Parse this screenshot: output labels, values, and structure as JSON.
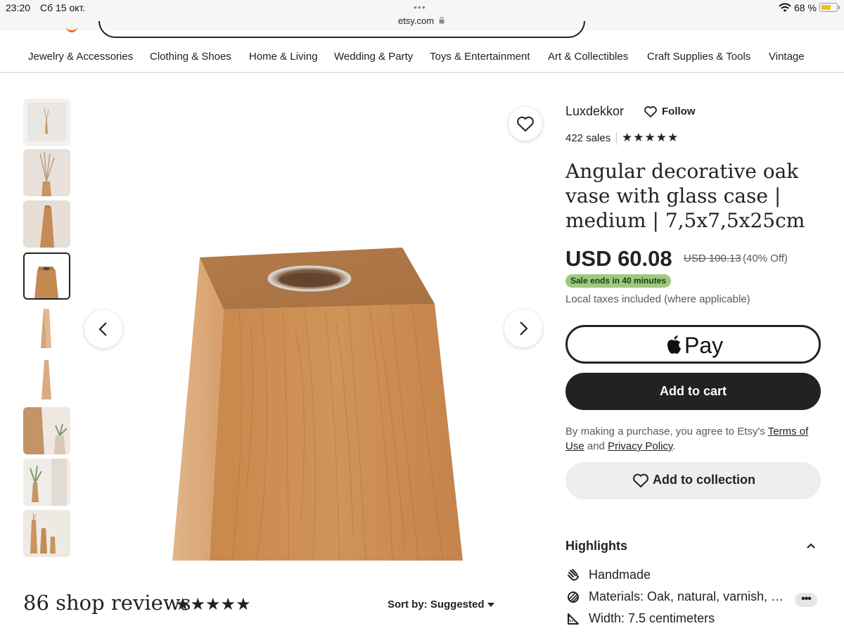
{
  "status_bar": {
    "time": "23:20",
    "date": "Сб 15 окт.",
    "url": "etsy.com",
    "battery_percent": "68 %",
    "battery_level": 0.68
  },
  "categories": [
    "Jewelry & Accessories",
    "Clothing & Shoes",
    "Home & Living",
    "Wedding & Party",
    "Toys & Entertainment",
    "Art & Collectibles",
    "Craft Supplies & Tools",
    "Vintage"
  ],
  "thumbnails": {
    "count": 9,
    "selected_index": 3
  },
  "shop": {
    "name": "Luxdekkor",
    "follow_label": "Follow",
    "sales": "422 sales",
    "rating_stars": 5
  },
  "product": {
    "title": "Angular decorative oak vase with glass case | medium | 7,5x7,5x25cm",
    "price": "USD 60.08",
    "original_price": "USD 100.13",
    "discount": "(40% Off)",
    "sale_badge": "Sale ends in 40 minutes",
    "taxes_note": "Local taxes included (where applicable)"
  },
  "actions": {
    "apple_pay_label": "Pay",
    "add_to_cart": "Add to cart",
    "legal_prefix": "By making a purchase, you agree to Etsy's",
    "terms_link": "Terms of Use",
    "legal_and": "and",
    "privacy_link": "Privacy Policy",
    "legal_suffix": ".",
    "add_to_collection": "Add to collection"
  },
  "highlights": {
    "heading": "Highlights",
    "items": [
      {
        "icon": "hand-icon",
        "text": "Handmade"
      },
      {
        "icon": "materials-icon",
        "text": "Materials: Oak, natural, varnish, …"
      },
      {
        "icon": "ruler-icon",
        "text": "Width: 7.5 centimeters"
      }
    ],
    "more_label": "•••"
  },
  "reviews": {
    "heading": "86 shop reviews",
    "rating_stars": 5,
    "sort_label": "Sort by: Suggested"
  },
  "colors": {
    "accent_orange": "#f1641e",
    "sale_green": "#9ec97f",
    "dark_button": "#222222",
    "wood": "#c98f55"
  }
}
